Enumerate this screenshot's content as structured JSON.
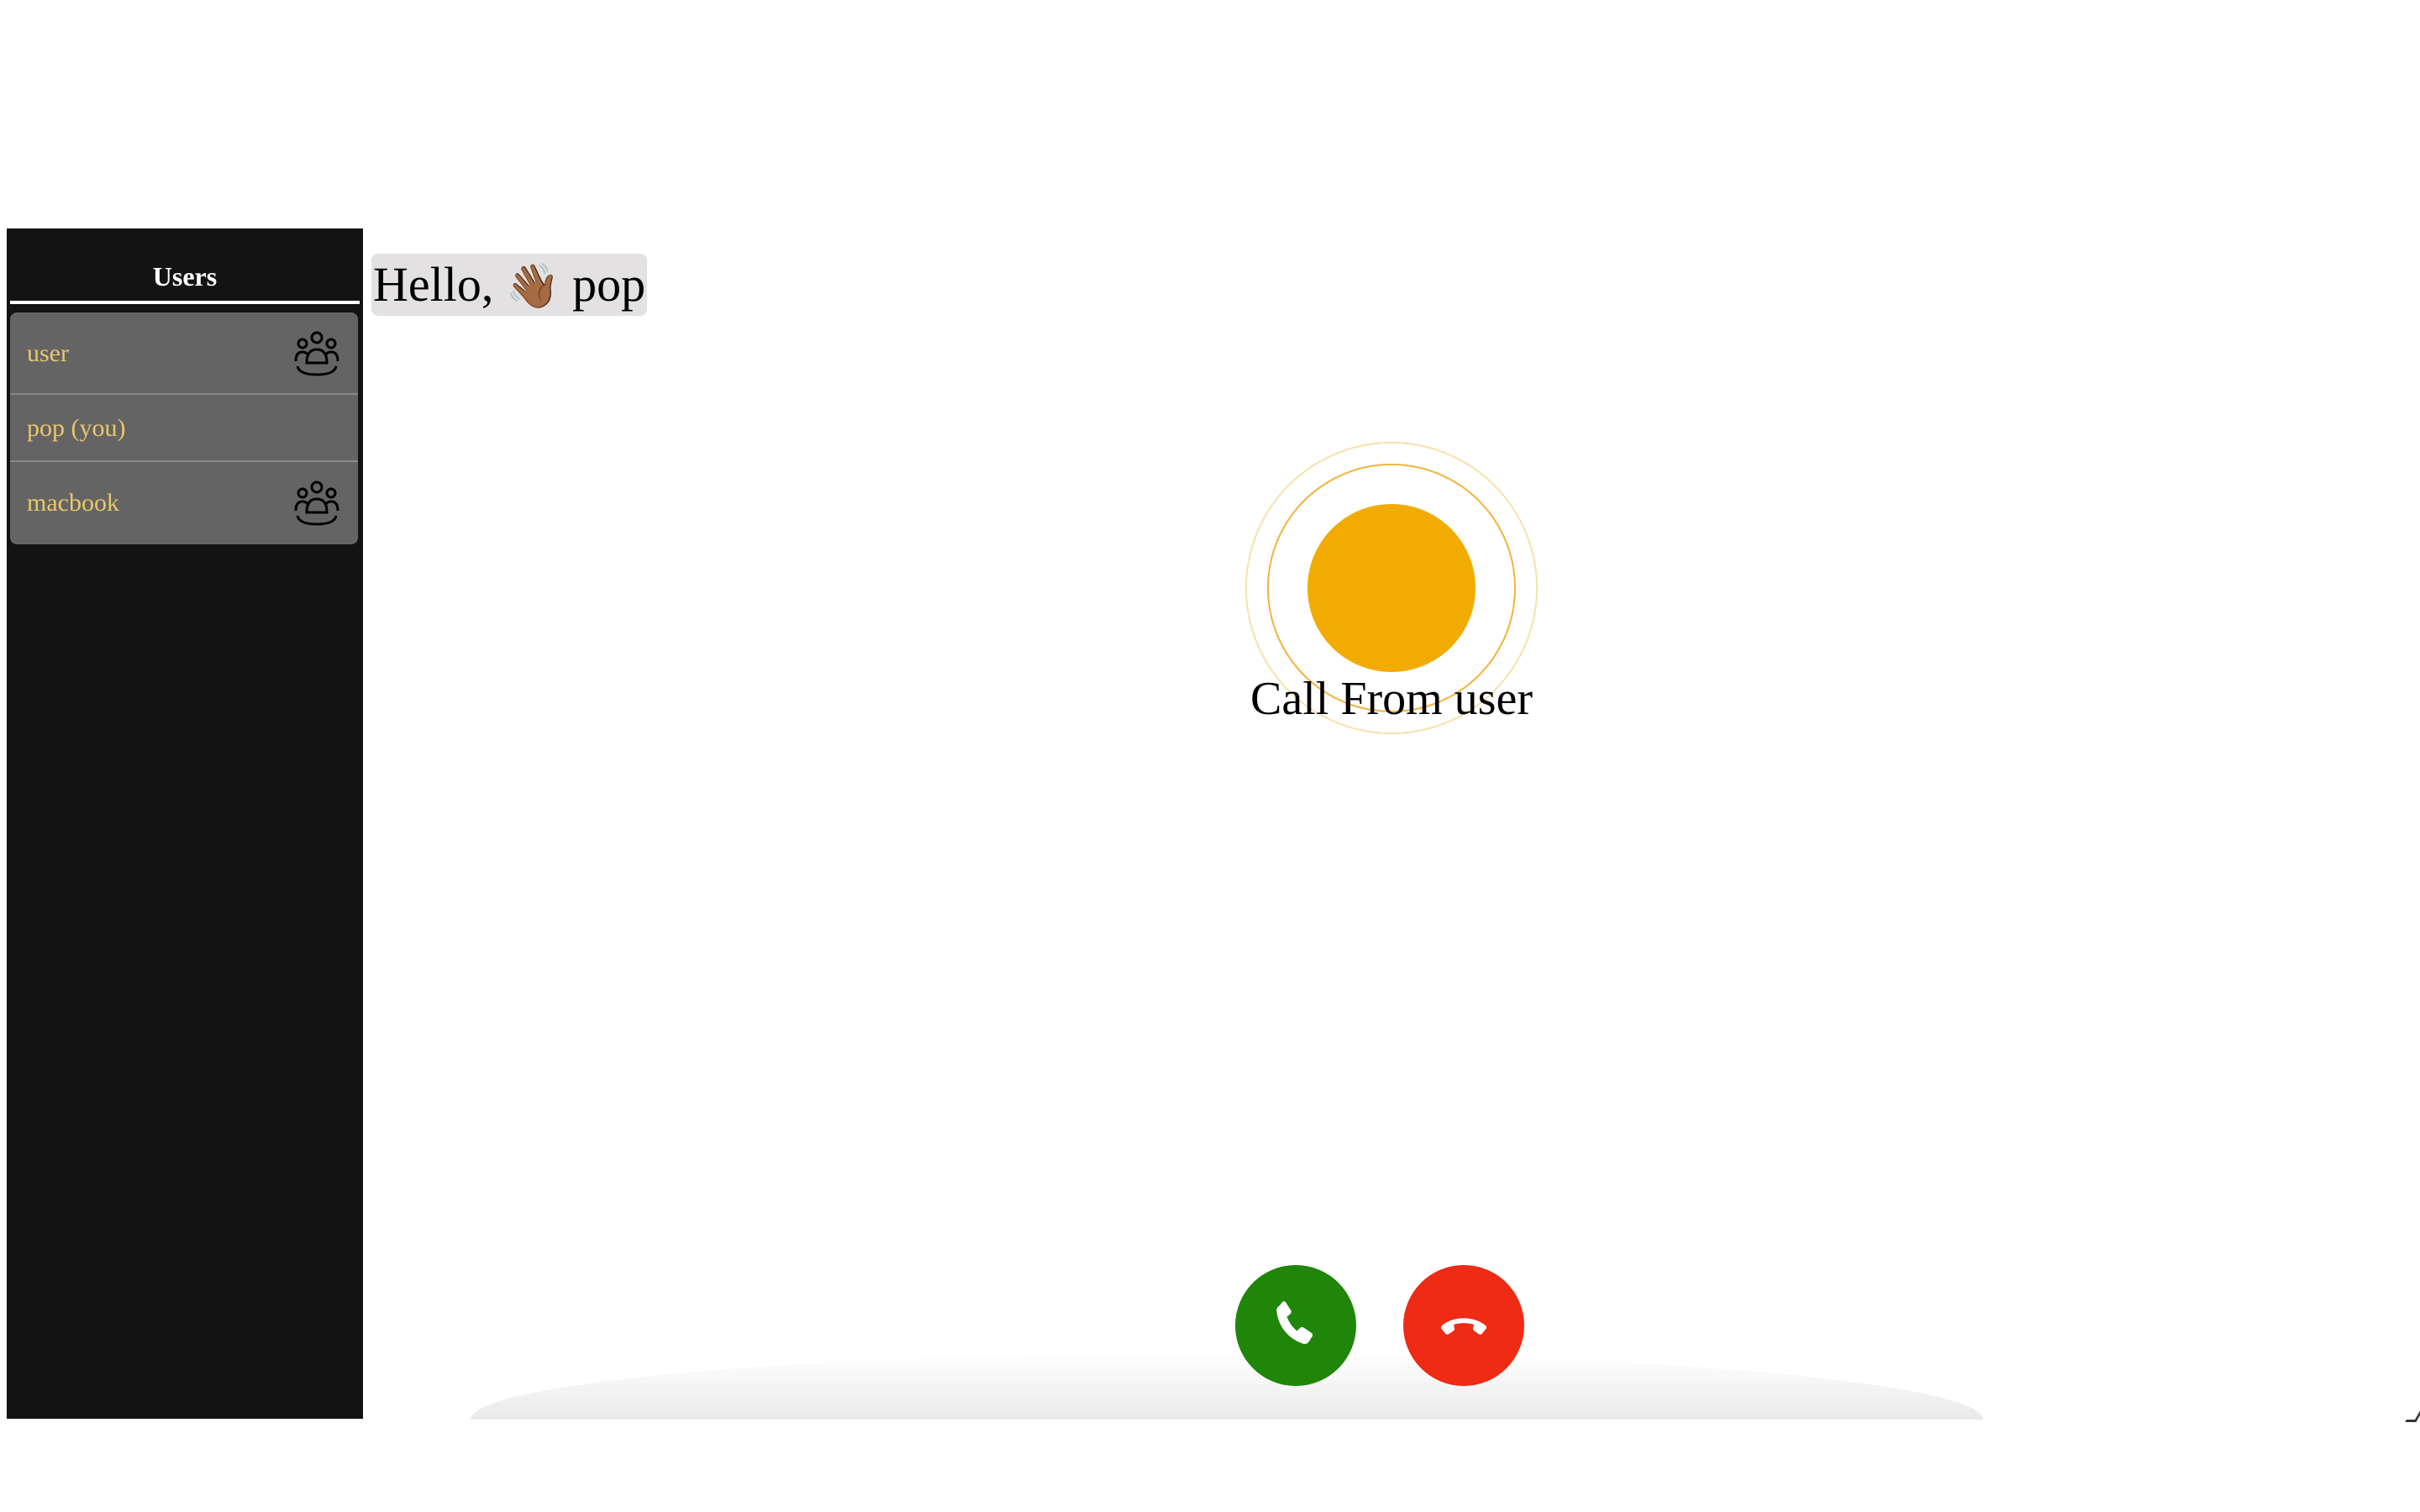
{
  "sidebar": {
    "title": "Users",
    "items": [
      {
        "label": "user",
        "icon": "group-icon"
      },
      {
        "label": "pop (you)",
        "icon": null
      },
      {
        "label": "macbook",
        "icon": "group-icon"
      }
    ]
  },
  "greeting": {
    "text": "Hello,",
    "emoji": "👋🏾",
    "name": "pop"
  },
  "call": {
    "label": "Call From user",
    "avatar_color": "#f2ab02",
    "accept_color": "#1f8609",
    "decline_color": "#ef2a15"
  },
  "colors": {
    "sidebar_bg": "#131313",
    "list_bg": "#656464",
    "list_text": "#e8c86a"
  }
}
